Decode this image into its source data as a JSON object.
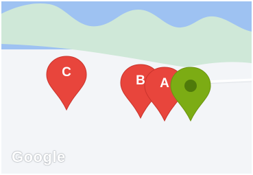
{
  "map": {
    "attribution_logo": "Google",
    "colors": {
      "water": "#9ec2f2",
      "park": "#cfe8d8",
      "land": "#f3f5f8",
      "road": "#ffffff",
      "marker_red": "#e8453c",
      "marker_red_dark": "#b3261e",
      "marker_green": "#7cac14",
      "marker_green_dark": "#4f7a0a"
    },
    "markers": [
      {
        "id": "C",
        "label": "C",
        "color": "red"
      },
      {
        "id": "B",
        "label": "B",
        "color": "red"
      },
      {
        "id": "A",
        "label": "A",
        "color": "red"
      },
      {
        "id": "current",
        "label": "",
        "color": "green"
      }
    ]
  }
}
